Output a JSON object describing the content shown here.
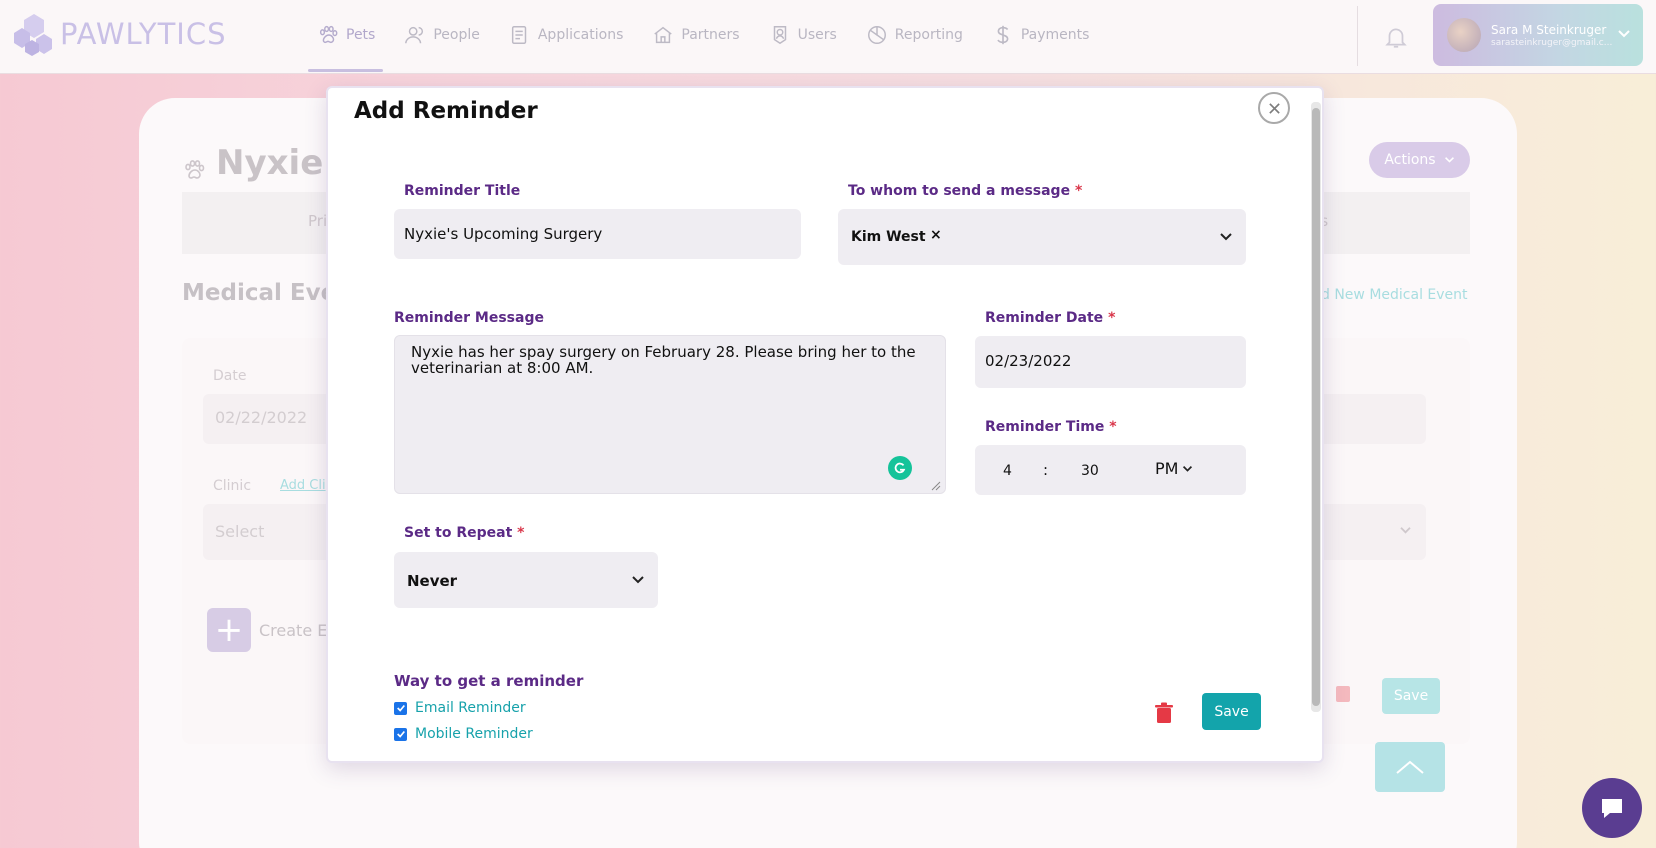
{
  "app": {
    "logo_text": "PAWLYTICS"
  },
  "nav": {
    "items": [
      {
        "label": "Pets",
        "icon": "paw-icon",
        "active": true
      },
      {
        "label": "People",
        "icon": "people-icon"
      },
      {
        "label": "Applications",
        "icon": "applications-icon"
      },
      {
        "label": "Partners",
        "icon": "home-icon"
      },
      {
        "label": "Users",
        "icon": "user-badge-icon"
      },
      {
        "label": "Reporting",
        "icon": "reporting-icon"
      },
      {
        "label": "Payments",
        "icon": "dollar-icon"
      }
    ]
  },
  "user": {
    "name": "Sara M Steinkruger",
    "email": "sarasteinkruger@gmail.c..."
  },
  "background_page": {
    "pet_name": "Nyxie",
    "actions_label": "Actions",
    "tab_left_partial": "Pri",
    "tab_right_partial": "nts",
    "section_title": "Medical Even",
    "add_event_link": "d New Medical Event",
    "date_label": "Date",
    "date_value": "02/22/2022",
    "clinic_label": "Clinic",
    "add_clinic_link": "Add Cli",
    "select_placeholder": "Select",
    "create_event_label": "Create Ev",
    "save_label": "Save"
  },
  "modal": {
    "title": "Add Reminder",
    "reminder_title": {
      "label": "Reminder Title",
      "value": "Nyxie's Upcoming Surgery"
    },
    "recipient": {
      "label": "To whom to send a message",
      "required": "*",
      "chip_name": "Kim West",
      "chip_remove": "×"
    },
    "message": {
      "label": "Reminder Message",
      "value": "Nyxie has her spay surgery on February 28. Please bring her to the veterinarian at 8:00 AM."
    },
    "date": {
      "label": "Reminder Date",
      "required": "*",
      "value": "02/23/2022"
    },
    "time": {
      "label": "Reminder Time",
      "required": "*",
      "hour": "4",
      "separator": ":",
      "minute": "30",
      "ampm": "PM"
    },
    "repeat": {
      "label": "Set to Repeat",
      "required": "*",
      "value": "Never"
    },
    "delivery": {
      "label": "Way to get a reminder",
      "options": [
        {
          "label": "Email Reminder",
          "checked": true
        },
        {
          "label": "Mobile Reminder",
          "checked": true
        }
      ]
    },
    "save_label": "Save"
  },
  "colors": {
    "accent_purple": "#5b2a86",
    "teal": "#13a4ab",
    "required": "#d9364a",
    "delete_red": "#e53945"
  }
}
